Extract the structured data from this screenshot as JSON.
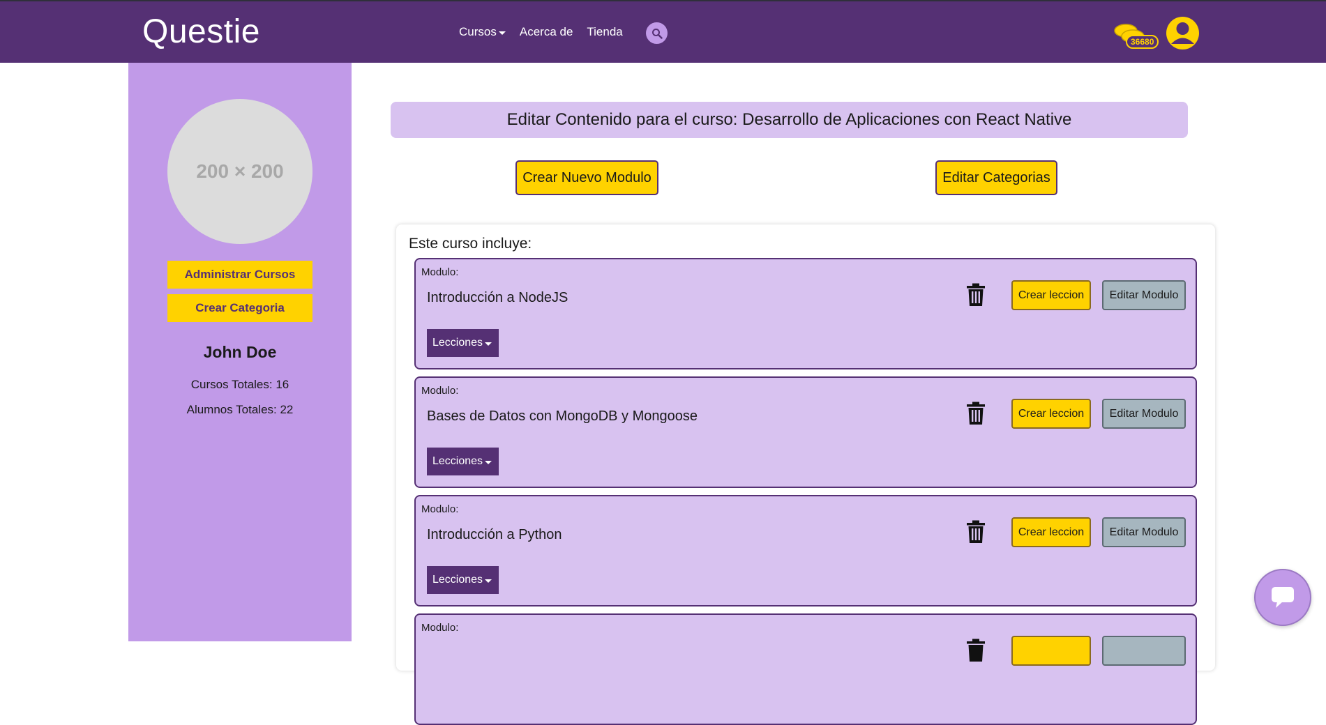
{
  "brand": "Questie",
  "nav": {
    "cursos": "Cursos",
    "acerca": "Acerca de",
    "tienda": "Tienda"
  },
  "coins": "36680",
  "sidebar": {
    "placeholder_text": "200 × 200",
    "admin_btn": "Administrar Cursos",
    "crear_categoria_btn": "Crear Categoria",
    "user_name": "John Doe",
    "cursos_totales": "Cursos Totales: 16",
    "alumnos_totales": "Alumnos Totales: 22"
  },
  "main": {
    "title": "Editar Contenido para el curso: Desarrollo de Aplicaciones con React Native",
    "crear_modulo_btn": "Crear Nuevo Modulo",
    "editar_categorias_btn": "Editar Categorias",
    "includes_heading": "Este curso incluye:",
    "modules": [
      {
        "label": "Modulo:",
        "title": "Introducción a NodeJS",
        "crear_leccion": "Crear leccion",
        "editar_modulo": "Editar Modulo",
        "lecciones": "Lecciones"
      },
      {
        "label": "Modulo:",
        "title": "Bases de Datos con MongoDB y Mongoose",
        "crear_leccion": "Crear leccion",
        "editar_modulo": "Editar Modulo",
        "lecciones": "Lecciones"
      },
      {
        "label": "Modulo:",
        "title": "Introducción a Python",
        "crear_leccion": "Crear leccion",
        "editar_modulo": "Editar Modulo",
        "lecciones": "Lecciones"
      },
      {
        "label": "Modulo:",
        "title": "",
        "crear_leccion": "",
        "editar_modulo": "",
        "lecciones": ""
      }
    ]
  },
  "colors": {
    "primary": "#553074",
    "lavender": "#c19ae8",
    "light_lavender": "#d8c2f0",
    "accent_yellow": "#ffd200",
    "gray_button": "#a6b6bf"
  },
  "icons": {
    "search": "search-icon",
    "coins": "coins-icon",
    "user": "user-avatar-icon",
    "trash": "trash-icon",
    "chat": "chat-icon",
    "caret": "caret-down-icon"
  }
}
